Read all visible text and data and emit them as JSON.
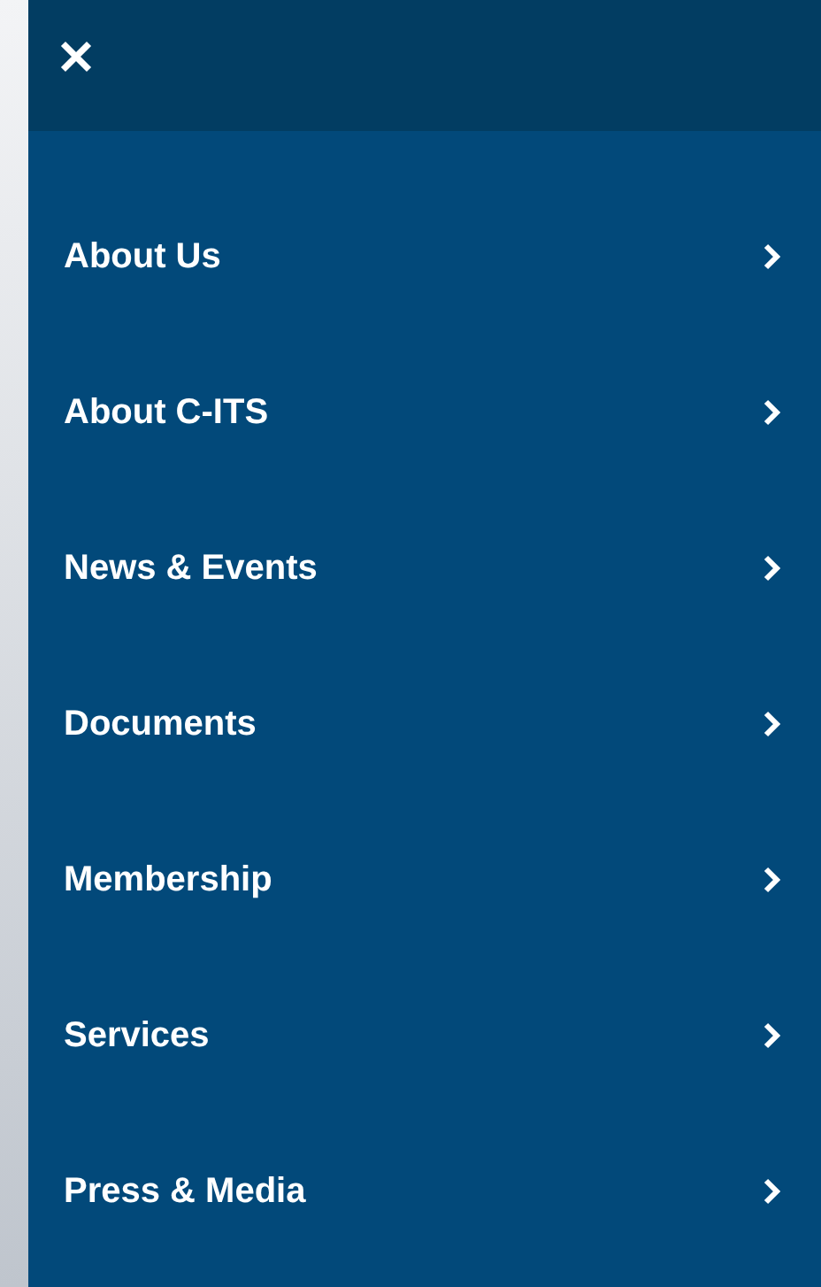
{
  "menu": {
    "items": [
      {
        "label": "About Us"
      },
      {
        "label": "About C-ITS"
      },
      {
        "label": "News & Events"
      },
      {
        "label": "Documents"
      },
      {
        "label": "Membership"
      },
      {
        "label": "Services"
      },
      {
        "label": "Press & Media"
      }
    ]
  }
}
